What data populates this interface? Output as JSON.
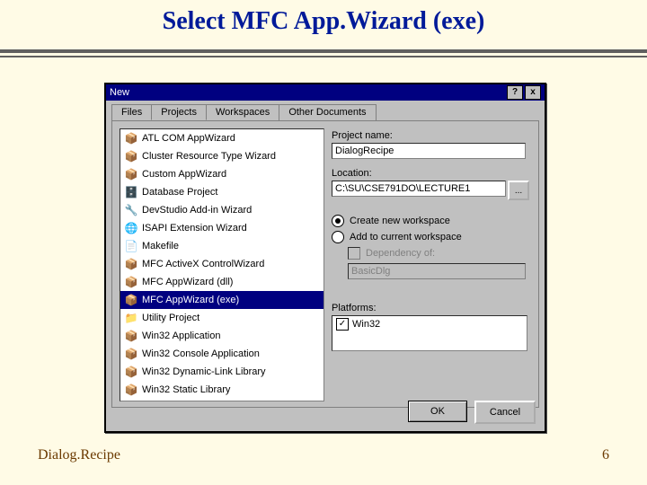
{
  "slide": {
    "title": "Select MFC App.Wizard (exe)",
    "footnote": "Dialog.Recipe",
    "page_number": "6"
  },
  "dialog": {
    "title": "New",
    "help_btn": "?",
    "close_btn": "x",
    "tabs": [
      "Files",
      "Projects",
      "Workspaces",
      "Other Documents"
    ],
    "active_tab": 1,
    "project_types": [
      "ATL COM AppWizard",
      "Cluster Resource Type Wizard",
      "Custom AppWizard",
      "Database Project",
      "DevStudio Add-in Wizard",
      "ISAPI Extension Wizard",
      "Makefile",
      "MFC ActiveX ControlWizard",
      "MFC AppWizard (dll)",
      "MFC AppWizard (exe)",
      "Utility Project",
      "Win32 Application",
      "Win32 Console Application",
      "Win32 Dynamic-Link Library",
      "Win32 Static Library"
    ],
    "selected_type": 9,
    "labels": {
      "project_name": "Project name:",
      "location": "Location:",
      "browse": "...",
      "create_new": "Create new workspace",
      "add_to": "Add to current workspace",
      "dependency": "Dependency of:",
      "platforms": "Platforms:"
    },
    "values": {
      "project_name": "DialogRecipe",
      "location": "C:\\SU\\CSE791DO\\LECTURE1",
      "dependency": "BasicDlg"
    },
    "workspace_radio": "create_new",
    "platforms": [
      {
        "name": "Win32",
        "checked": true
      }
    ],
    "buttons": {
      "ok": "OK",
      "cancel": "Cancel"
    }
  },
  "icons": {
    "types": [
      "📦",
      "📦",
      "📦",
      "🗄️",
      "🔧",
      "🌐",
      "📄",
      "📦",
      "📦",
      "📦",
      "📁",
      "📦",
      "📦",
      "📦",
      "📦"
    ]
  }
}
